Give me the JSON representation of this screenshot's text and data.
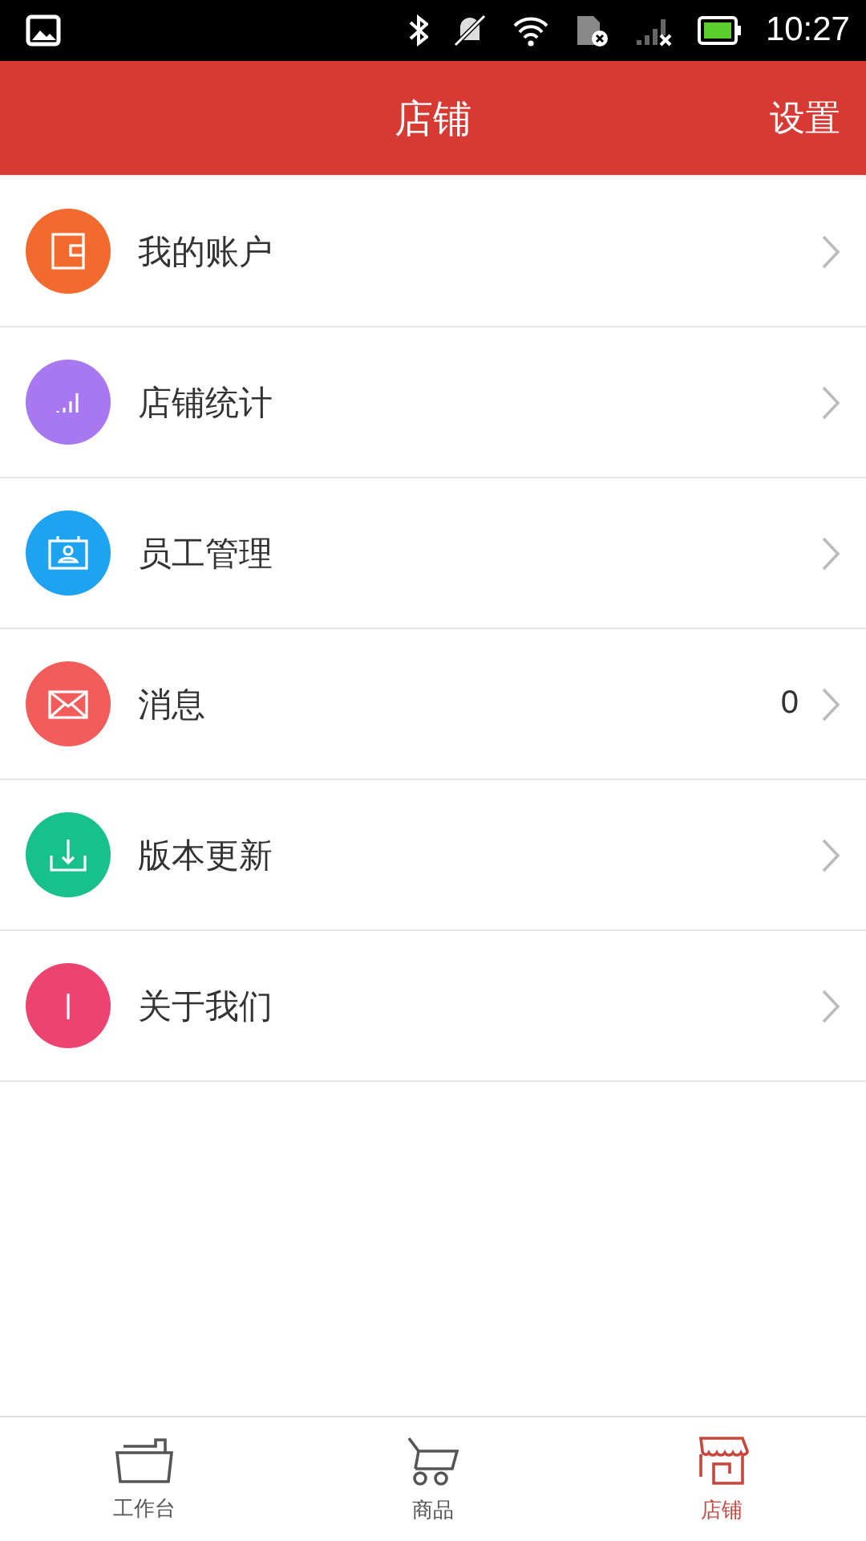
{
  "status_bar": {
    "time": "10:27"
  },
  "header": {
    "title": "店铺",
    "action": "设置"
  },
  "menu": [
    {
      "label": "我的账户",
      "kind": "wallet",
      "color": "#f26a2e"
    },
    {
      "label": "店铺统计",
      "kind": "stats",
      "color": "#a878f0"
    },
    {
      "label": "员工管理",
      "kind": "staff",
      "color": "#1ea3f0"
    },
    {
      "label": "消息",
      "kind": "mail",
      "color": "#f25c5a",
      "count": "0"
    },
    {
      "label": "版本更新",
      "kind": "download",
      "color": "#18c08a"
    },
    {
      "label": "关于我们",
      "kind": "info",
      "color": "#ec4370"
    }
  ],
  "tabs": [
    {
      "label": "工作台",
      "kind": "folder",
      "selected": false
    },
    {
      "label": "商品",
      "kind": "cart",
      "selected": false
    },
    {
      "label": "店铺",
      "kind": "shop",
      "selected": true
    }
  ]
}
